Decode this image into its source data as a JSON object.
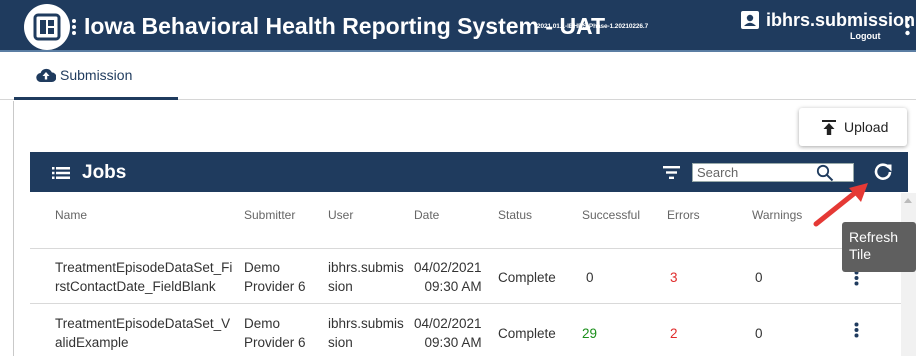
{
  "app": {
    "title": "Iowa Behavioral Health Reporting System - UAT",
    "version": "2021.01.1-IBHRS-Phase-1.20210226.7",
    "username": "ibhrs.submission",
    "logout": "Logout",
    "brand_color": "#1f3b5e"
  },
  "tabs": [
    {
      "label": "Submission",
      "icon": "cloud-upload-icon",
      "active": true
    }
  ],
  "toolbar": {
    "upload_label": "Upload"
  },
  "jobs": {
    "title": "Jobs",
    "search_placeholder": "Search",
    "columns": [
      "Name",
      "Submitter",
      "User",
      "Date",
      "Status",
      "Successful",
      "Errors",
      "Warnings"
    ],
    "rows": [
      {
        "name_line1": "TreatmentEpisodeDataSet_Fi",
        "name_line2": "rstContactDate_FieldBlank",
        "submitter_line1": "Demo",
        "submitter_line2": "Provider 6",
        "user_line1": "ibhrs.submis",
        "user_line2": "sion",
        "date_line1": "04/02/2021",
        "date_line2": "09:30 AM",
        "status": "Complete",
        "successful": "0",
        "errors": "3",
        "warnings": "0"
      },
      {
        "name_line1": "TreatmentEpisodeDataSet_V",
        "name_line2": "alidExample",
        "submitter_line1": "Demo",
        "submitter_line2": "Provider 6",
        "user_line1": "ibhrs.submis",
        "user_line2": "sion",
        "date_line1": "04/02/2021",
        "date_line2": "09:30 AM",
        "status": "Complete",
        "successful": "29",
        "errors": "2",
        "warnings": "0"
      }
    ]
  },
  "tooltip": {
    "text": "Refresh Tile"
  },
  "colors": {
    "error": "#e02b2b",
    "success": "#1a8f1a",
    "annotation_arrow": "#e53935"
  }
}
